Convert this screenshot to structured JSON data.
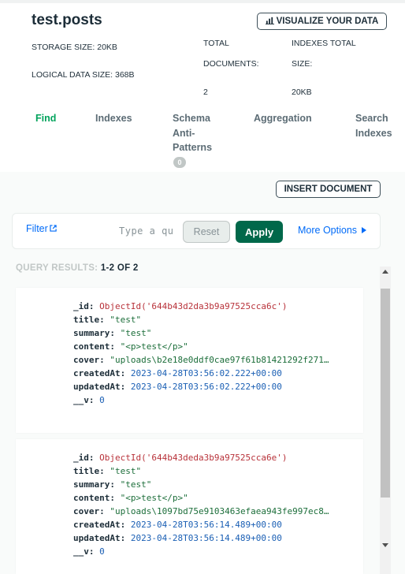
{
  "collection": {
    "name": "test.posts",
    "visualize_label": "VISUALIZE YOUR DATA",
    "storage_size": "STORAGE SIZE: 20KB",
    "logical_data_size": "LOGICAL DATA SIZE: 368B",
    "total_documents_label_1": "TOTAL",
    "total_documents_label_2": "DOCUMENTS:",
    "total_documents_value": "2",
    "indexes_total_label_1": "INDEXES TOTAL",
    "indexes_total_label_2": "SIZE:",
    "indexes_total_value": "20KB"
  },
  "tabs": [
    {
      "lines": [
        "Find"
      ],
      "active": true
    },
    {
      "lines": [
        "Indexes"
      ]
    },
    {
      "lines": [
        "Schema",
        "Anti-",
        "Patterns"
      ],
      "badge": "0"
    },
    {
      "lines": [
        "Aggregation"
      ]
    },
    {
      "lines": [
        "Search",
        "Indexes"
      ]
    }
  ],
  "toolbar": {
    "insert_document": "INSERT DOCUMENT"
  },
  "filter": {
    "label": "Filter",
    "input_text": "Type a qu",
    "reset_label": "Reset",
    "apply_label": "Apply",
    "more_options_label": "More Options"
  },
  "results": {
    "header_prefix": "QUERY RESULTS: ",
    "header_range": "1-2 OF 2"
  },
  "documents": [
    {
      "fields": [
        {
          "key": "_id:",
          "value": "ObjectId('644b43d2da3b9a97525cca6c')",
          "type": "oid"
        },
        {
          "key": "title:",
          "value": "\"test\"",
          "type": "str"
        },
        {
          "key": "summary:",
          "value": "\"test\"",
          "type": "str"
        },
        {
          "key": "content:",
          "value": "\"<p>test</p>\"",
          "type": "str"
        },
        {
          "key": "cover:",
          "value": "\"uploads\\b2e18e0ddf0cae97f61b81421292f271…",
          "type": "str"
        },
        {
          "key": "createdAt:",
          "value": "2023-04-28T03:56:02.222+00:00",
          "type": "date"
        },
        {
          "key": "updatedAt:",
          "value": "2023-04-28T03:56:02.222+00:00",
          "type": "date"
        },
        {
          "key": "__v:",
          "value": "0",
          "type": "num"
        }
      ]
    },
    {
      "fields": [
        {
          "key": "_id:",
          "value": "ObjectId('644b43deda3b9a97525cca6e')",
          "type": "oid"
        },
        {
          "key": "title:",
          "value": "\"test\"",
          "type": "str"
        },
        {
          "key": "summary:",
          "value": "\"test\"",
          "type": "str"
        },
        {
          "key": "content:",
          "value": "\"<p>test</p>\"",
          "type": "str"
        },
        {
          "key": "cover:",
          "value": "\"uploads\\1097bd75e9103463efaea943fe997ec8…",
          "type": "str"
        },
        {
          "key": "createdAt:",
          "value": "2023-04-28T03:56:14.489+00:00",
          "type": "date"
        },
        {
          "key": "updatedAt:",
          "value": "2023-04-28T03:56:14.489+00:00",
          "type": "date"
        },
        {
          "key": "__v:",
          "value": "0",
          "type": "num"
        }
      ]
    }
  ],
  "icons": {
    "chart": "bar-chart-icon",
    "external_link": "external-link-icon",
    "caret": "caret-right-icon"
  },
  "colors": {
    "active_tab": "#00a35c",
    "apply": "#00684a",
    "link": "#016bf8",
    "objectid": "#b8323a",
    "string": "#1c6e3a",
    "date": "#1a5fb4"
  }
}
